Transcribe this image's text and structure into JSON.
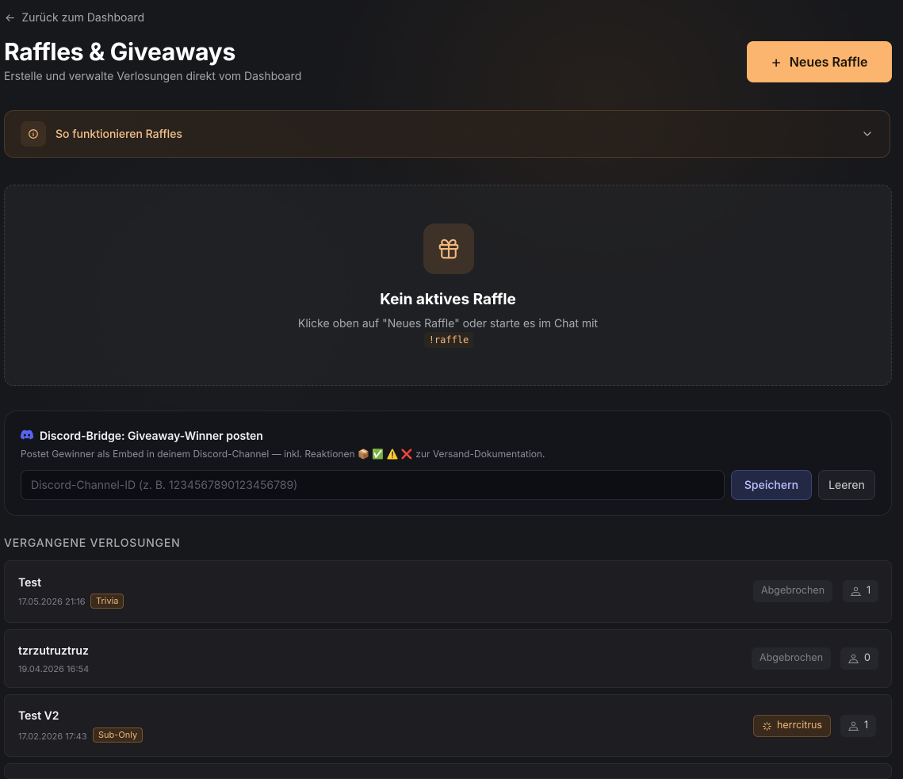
{
  "nav": {
    "back_arrow": "←",
    "back_label": "Zurück zum Dashboard"
  },
  "header": {
    "title": "Raffles & Giveaways",
    "subtitle": "Erstelle und verwalte Verlosungen direkt vom Dashboard",
    "new_button_icon": "+",
    "new_button_label": "Neues Raffle"
  },
  "howto": {
    "label": "So funktionieren Raffles",
    "icon": "info-icon",
    "toggle_icon": "chevron-down-icon"
  },
  "empty_state": {
    "icon": "gift-icon",
    "heading": "Kein aktives Raffle",
    "text": "Klicke oben auf \"Neues Raffle\" oder starte es im Chat mit",
    "command": "!raffle"
  },
  "discord": {
    "heading": "Discord-Bridge: Giveaway-Winner posten",
    "description": "Postet Gewinner als Embed in deinem Discord-Channel — inkl. Reaktionen 📦 ✅ ⚠️ ❌ zur Versand-Dokumentation.",
    "input_value": "",
    "input_placeholder": "Discord-Channel-ID (z. B. 1234567890123456789)",
    "save_label": "Speichern",
    "clear_label": "Leeren",
    "accent": "#5865f2"
  },
  "past": {
    "title": "Vergangene Verlosungen",
    "rows": [
      {
        "name": "Test",
        "date": "17.05.2026 21:16",
        "tag": "Trivia",
        "status": "Abgebrochen",
        "participants": "1"
      },
      {
        "name": "tzrzutruztruz",
        "date": "19.04.2026 16:54",
        "tag": "",
        "status": "Abgebrochen",
        "participants": "0"
      },
      {
        "name": "Test V2",
        "date": "17.02.2026 17:43",
        "tag": "Sub-Only",
        "winner": "herrcitrus",
        "participants": "1"
      }
    ]
  },
  "colors": {
    "accent": "#fcb56e",
    "background": "#17181c"
  }
}
